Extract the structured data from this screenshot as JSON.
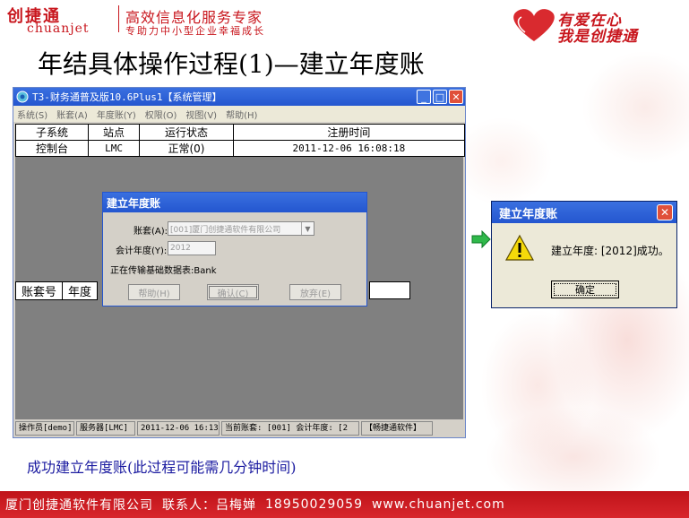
{
  "header": {
    "brand_cn": "创捷通",
    "brand_en": "chuanjet",
    "slogan_main": "高效信息化服务专家",
    "slogan_sub": "专助力中小型企业幸福成长",
    "heart_line1": "有爱在心",
    "heart_line2": "我是创捷通"
  },
  "slide_title": "年结具体操作过程(1)—建立年度账",
  "main_window": {
    "title": "T3-财务通普及版10.6Plus1【系统管理】",
    "menu": [
      "系统(S)",
      "账套(A)",
      "年度账(Y)",
      "权限(O)",
      "视图(V)",
      "帮助(H)"
    ],
    "top_table": {
      "headers": [
        "子系统",
        "站点",
        "运行状态",
        "注册时间"
      ],
      "rows": [
        [
          "控制台",
          "LMC",
          "正常(0)",
          "2011-12-06 16:08:18"
        ]
      ]
    },
    "bottom_table_headers": [
      "账套号",
      "年度"
    ],
    "status": [
      "操作员[demo]",
      "服务器[LMC]",
      "2011-12-06 16:13",
      "当前账套: [001] 会计年度: [2",
      "【畅捷通软件】"
    ]
  },
  "inner_dialog": {
    "title": "建立年度账",
    "account_label": "账套(A):",
    "account_value": "[001]厦门创捷通软件有限公司",
    "year_label": "会计年度(Y):",
    "year_value": "2012",
    "progress_text": "正在传输基础数据表:Bank",
    "help_btn": "帮助(H)",
    "ok_btn": "确认(C)",
    "cancel_btn": "放弃(E)"
  },
  "message_box": {
    "title": "建立年度账",
    "text": "建立年度: [2012]成功。",
    "ok_btn": "确定"
  },
  "caption": "成功建立年度账(此过程可能需几分钟时间)",
  "footer": {
    "company": "厦门创捷通软件有限公司",
    "contact": "联系人：吕梅婵",
    "phone": "18950029059",
    "website": "www.chuanjet.com"
  },
  "colors": {
    "brand_red": "#c8161d",
    "xp_blue": "#2456cf",
    "caption_blue": "#1a1aa0"
  }
}
